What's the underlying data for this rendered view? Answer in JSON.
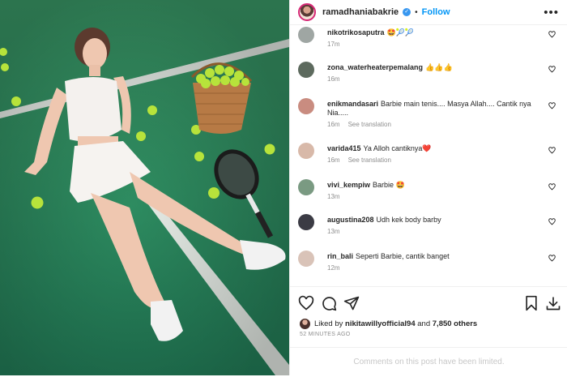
{
  "post": {
    "username": "ramadhaniabakrie",
    "separator": "•",
    "follow_label": "Follow",
    "more_label": "•••"
  },
  "comments": [
    {
      "user": "nikotrikosaputra",
      "text": "🤩🎾🎾",
      "time": "17m",
      "translate": ""
    },
    {
      "user": "zona_waterheaterpemalang",
      "text": "👍👍👍",
      "time": "16m",
      "translate": ""
    },
    {
      "user": "enikmandasari",
      "text": "Barbie main tenis.... Masya Allah.... Cantik nya Nia.....",
      "time": "16m",
      "translate": "See translation"
    },
    {
      "user": "varida415",
      "text": "Ya Alloh cantiknya❤️",
      "time": "16m",
      "translate": "See translation"
    },
    {
      "user": "vivi_kempiw",
      "text": "Barbie 🤩",
      "time": "13m",
      "translate": ""
    },
    {
      "user": "augustina208",
      "text": "Udh kek body barby",
      "time": "13m",
      "translate": ""
    },
    {
      "user": "rin_bali",
      "text": "Seperti Barbie, cantik banget",
      "time": "12m",
      "translate": ""
    }
  ],
  "likes": {
    "prefix": "Liked by",
    "user": "nikitawillyofficial94",
    "conjunction": "and",
    "others": "7,850 others"
  },
  "timestamp": "52 MINUTES AGO",
  "comments_limited": "Comments on this post have been limited.",
  "icons": {
    "like": "heart-icon",
    "comment": "comment-icon",
    "share": "send-icon",
    "save": "bookmark-icon",
    "download": "download-icon"
  },
  "colors": {
    "court_green": "#2f8f5f",
    "link_blue": "#0095f6",
    "verified_blue": "#3897f0"
  }
}
